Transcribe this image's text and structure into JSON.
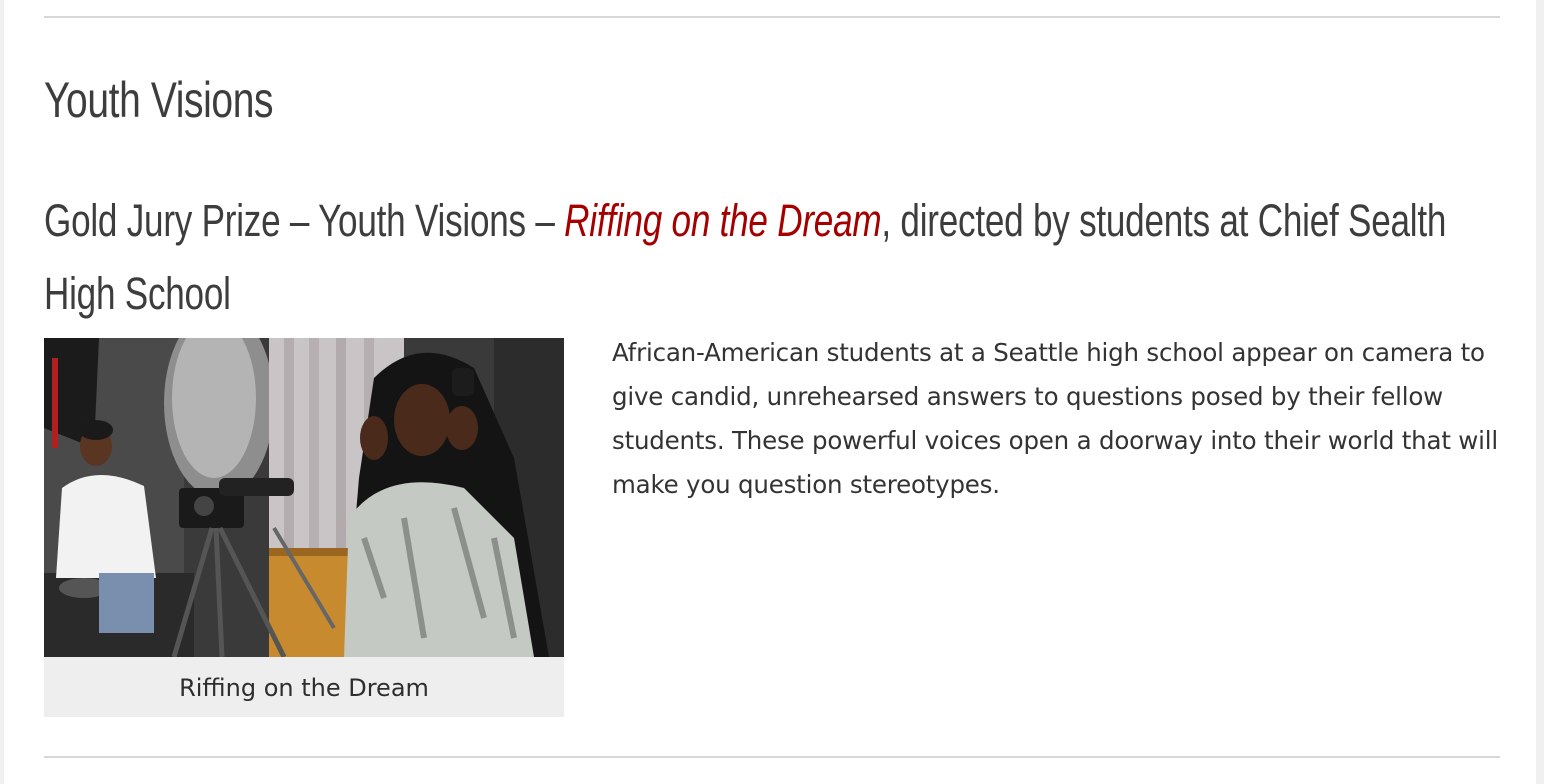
{
  "section": {
    "title": "Youth Visions"
  },
  "award": {
    "prefix": "Gold Jury Prize – Youth Visions – ",
    "film_title": "Riffing on the Dream",
    "suffix": ", directed by students at Chief Sealth High School"
  },
  "figure": {
    "caption": "Riffing on the Dream"
  },
  "description": {
    "text": "African-American students at a Seattle high school appear on camera to give candid, unrehearsed answers to questions posed by their fellow students. These powerful voices open a doorway into their world that will make you question stereotypes."
  },
  "colors": {
    "film_title": "#a50000",
    "heading": "#3d3d3d",
    "body_text": "#333333",
    "caption_bg": "#eeeeee",
    "rule": "#d8d8d8"
  }
}
